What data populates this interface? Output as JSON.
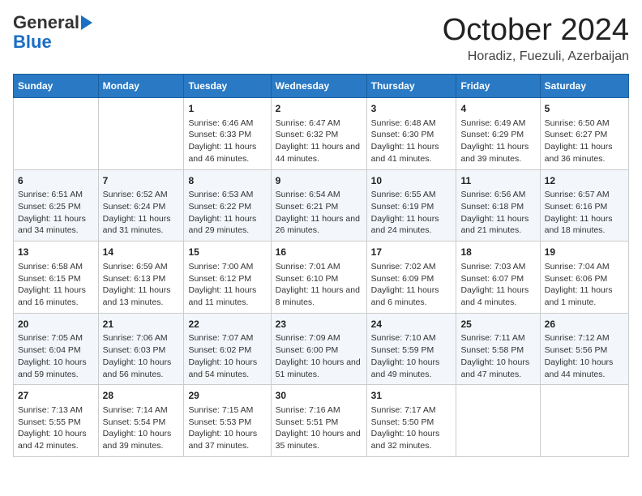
{
  "header": {
    "logo_general": "General",
    "logo_blue": "Blue",
    "month_title": "October 2024",
    "subtitle": "Horadiz, Fuezuli, Azerbaijan"
  },
  "days_of_week": [
    "Sunday",
    "Monday",
    "Tuesday",
    "Wednesday",
    "Thursday",
    "Friday",
    "Saturday"
  ],
  "weeks": [
    [
      {
        "day": "",
        "content": ""
      },
      {
        "day": "",
        "content": ""
      },
      {
        "day": "1",
        "content": "Sunrise: 6:46 AM\nSunset: 6:33 PM\nDaylight: 11 hours and 46 minutes."
      },
      {
        "day": "2",
        "content": "Sunrise: 6:47 AM\nSunset: 6:32 PM\nDaylight: 11 hours and 44 minutes."
      },
      {
        "day": "3",
        "content": "Sunrise: 6:48 AM\nSunset: 6:30 PM\nDaylight: 11 hours and 41 minutes."
      },
      {
        "day": "4",
        "content": "Sunrise: 6:49 AM\nSunset: 6:29 PM\nDaylight: 11 hours and 39 minutes."
      },
      {
        "day": "5",
        "content": "Sunrise: 6:50 AM\nSunset: 6:27 PM\nDaylight: 11 hours and 36 minutes."
      }
    ],
    [
      {
        "day": "6",
        "content": "Sunrise: 6:51 AM\nSunset: 6:25 PM\nDaylight: 11 hours and 34 minutes."
      },
      {
        "day": "7",
        "content": "Sunrise: 6:52 AM\nSunset: 6:24 PM\nDaylight: 11 hours and 31 minutes."
      },
      {
        "day": "8",
        "content": "Sunrise: 6:53 AM\nSunset: 6:22 PM\nDaylight: 11 hours and 29 minutes."
      },
      {
        "day": "9",
        "content": "Sunrise: 6:54 AM\nSunset: 6:21 PM\nDaylight: 11 hours and 26 minutes."
      },
      {
        "day": "10",
        "content": "Sunrise: 6:55 AM\nSunset: 6:19 PM\nDaylight: 11 hours and 24 minutes."
      },
      {
        "day": "11",
        "content": "Sunrise: 6:56 AM\nSunset: 6:18 PM\nDaylight: 11 hours and 21 minutes."
      },
      {
        "day": "12",
        "content": "Sunrise: 6:57 AM\nSunset: 6:16 PM\nDaylight: 11 hours and 18 minutes."
      }
    ],
    [
      {
        "day": "13",
        "content": "Sunrise: 6:58 AM\nSunset: 6:15 PM\nDaylight: 11 hours and 16 minutes."
      },
      {
        "day": "14",
        "content": "Sunrise: 6:59 AM\nSunset: 6:13 PM\nDaylight: 11 hours and 13 minutes."
      },
      {
        "day": "15",
        "content": "Sunrise: 7:00 AM\nSunset: 6:12 PM\nDaylight: 11 hours and 11 minutes."
      },
      {
        "day": "16",
        "content": "Sunrise: 7:01 AM\nSunset: 6:10 PM\nDaylight: 11 hours and 8 minutes."
      },
      {
        "day": "17",
        "content": "Sunrise: 7:02 AM\nSunset: 6:09 PM\nDaylight: 11 hours and 6 minutes."
      },
      {
        "day": "18",
        "content": "Sunrise: 7:03 AM\nSunset: 6:07 PM\nDaylight: 11 hours and 4 minutes."
      },
      {
        "day": "19",
        "content": "Sunrise: 7:04 AM\nSunset: 6:06 PM\nDaylight: 11 hours and 1 minute."
      }
    ],
    [
      {
        "day": "20",
        "content": "Sunrise: 7:05 AM\nSunset: 6:04 PM\nDaylight: 10 hours and 59 minutes."
      },
      {
        "day": "21",
        "content": "Sunrise: 7:06 AM\nSunset: 6:03 PM\nDaylight: 10 hours and 56 minutes."
      },
      {
        "day": "22",
        "content": "Sunrise: 7:07 AM\nSunset: 6:02 PM\nDaylight: 10 hours and 54 minutes."
      },
      {
        "day": "23",
        "content": "Sunrise: 7:09 AM\nSunset: 6:00 PM\nDaylight: 10 hours and 51 minutes."
      },
      {
        "day": "24",
        "content": "Sunrise: 7:10 AM\nSunset: 5:59 PM\nDaylight: 10 hours and 49 minutes."
      },
      {
        "day": "25",
        "content": "Sunrise: 7:11 AM\nSunset: 5:58 PM\nDaylight: 10 hours and 47 minutes."
      },
      {
        "day": "26",
        "content": "Sunrise: 7:12 AM\nSunset: 5:56 PM\nDaylight: 10 hours and 44 minutes."
      }
    ],
    [
      {
        "day": "27",
        "content": "Sunrise: 7:13 AM\nSunset: 5:55 PM\nDaylight: 10 hours and 42 minutes."
      },
      {
        "day": "28",
        "content": "Sunrise: 7:14 AM\nSunset: 5:54 PM\nDaylight: 10 hours and 39 minutes."
      },
      {
        "day": "29",
        "content": "Sunrise: 7:15 AM\nSunset: 5:53 PM\nDaylight: 10 hours and 37 minutes."
      },
      {
        "day": "30",
        "content": "Sunrise: 7:16 AM\nSunset: 5:51 PM\nDaylight: 10 hours and 35 minutes."
      },
      {
        "day": "31",
        "content": "Sunrise: 7:17 AM\nSunset: 5:50 PM\nDaylight: 10 hours and 32 minutes."
      },
      {
        "day": "",
        "content": ""
      },
      {
        "day": "",
        "content": ""
      }
    ]
  ]
}
